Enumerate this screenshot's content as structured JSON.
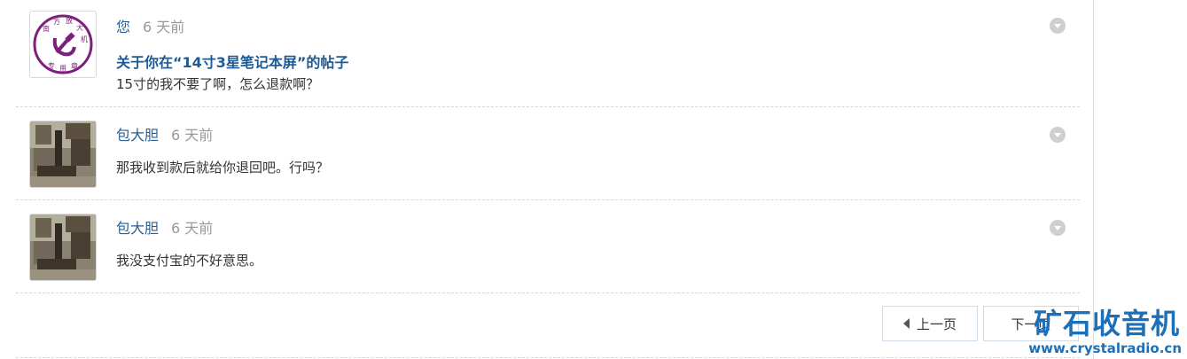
{
  "messages": [
    {
      "author": "您",
      "time": "6 天前",
      "subject": "关于你在“14寸3星笔记本屏”的帖子",
      "body": "15寸的我不要了啊，怎么退款啊？",
      "avatar_seal_text": "南方放大机专用章"
    },
    {
      "author": "包大胆",
      "time": "6 天前",
      "body": "那我收到款后就给你退回吧。行吗？"
    },
    {
      "author": "包大胆",
      "time": "6 天前",
      "body": "我没支付宝的不好意思。"
    }
  ],
  "pagination": {
    "prev_label": "上一页",
    "next_label": "下一页"
  },
  "watermark": {
    "cn": "矿石收音机",
    "url": "www.crystalradio.cn"
  },
  "colors": {
    "link": "#2b5e8f",
    "subject": "#1e5a94",
    "watermark": "#1d6fb8",
    "seal": "#7d1f7d"
  }
}
